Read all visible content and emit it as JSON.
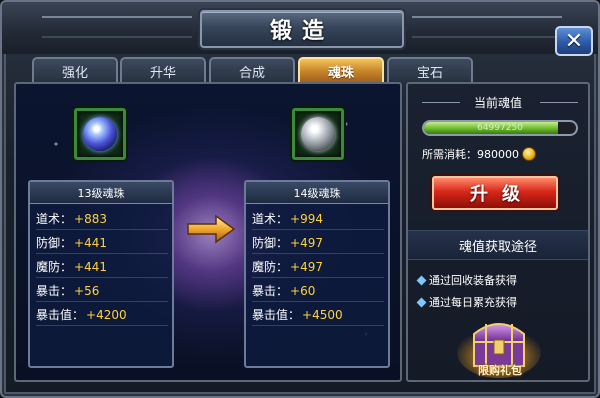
{
  "window": {
    "title": "锻造",
    "close_symbol": "✕"
  },
  "tabs": [
    {
      "label": "强化",
      "active": false
    },
    {
      "label": "升华",
      "active": false
    },
    {
      "label": "合成",
      "active": false
    },
    {
      "label": "魂珠",
      "active": true
    },
    {
      "label": "宝石",
      "active": false
    }
  ],
  "current": {
    "gem_icon": "blue-soul-orb-icon",
    "title": "13级魂珠",
    "stats": [
      {
        "key": "道术：",
        "value": "+883"
      },
      {
        "key": "防御：",
        "value": "+441"
      },
      {
        "key": "魔防：",
        "value": "+441"
      },
      {
        "key": "暴击：",
        "value": "+56"
      },
      {
        "key": "暴击值：",
        "value": "+4200"
      }
    ]
  },
  "next": {
    "gem_icon": "silver-soul-orb-icon",
    "title": "14级魂珠",
    "stats": [
      {
        "key": "道术：",
        "value": "+994"
      },
      {
        "key": "防御：",
        "value": "+497"
      },
      {
        "key": "魔防：",
        "value": "+497"
      },
      {
        "key": "暴击：",
        "value": "+60"
      },
      {
        "key": "暴击值：",
        "value": "+4500"
      }
    ]
  },
  "soul": {
    "title": "当前魂值",
    "progress_text": "64997250",
    "progress_percent": 88,
    "cost_label": "所需消耗：980000",
    "upgrade_label": "升级"
  },
  "ways": {
    "title": "魂值获取途径",
    "items": [
      "通过回收装备获得",
      "通过每日累充获得"
    ],
    "gift_label": "限购礼包"
  },
  "colors": {
    "active_tab": "#e0a040",
    "stat_value": "#ffd23a",
    "upgrade_button": "#d8281a",
    "progress_fill": "#64b428"
  }
}
